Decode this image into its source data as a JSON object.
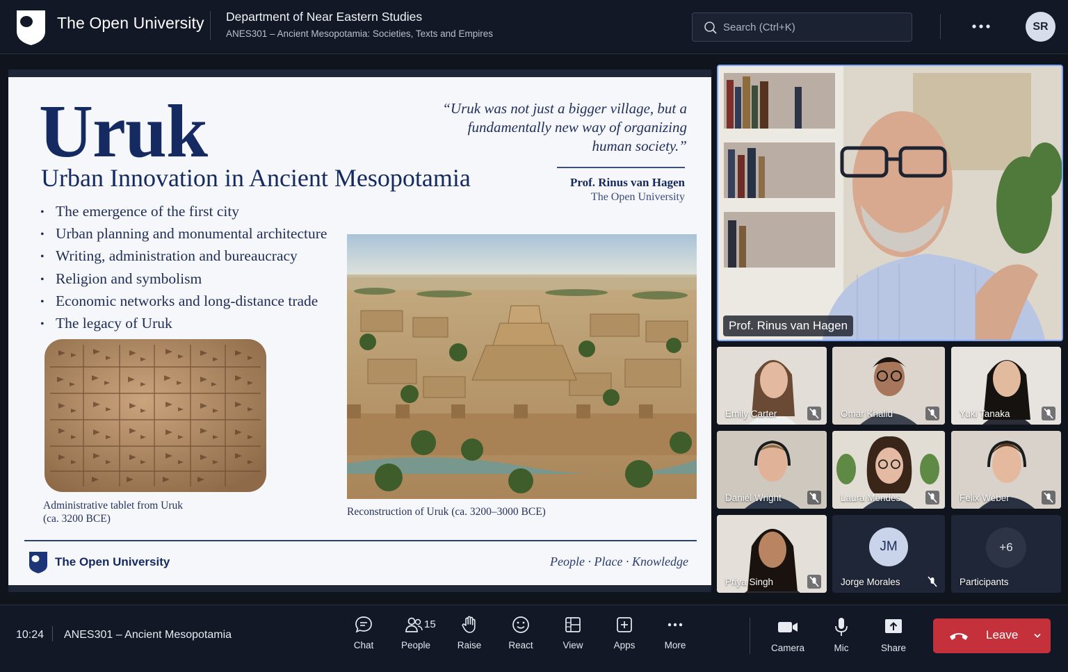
{
  "topbar": {
    "brand": "The Open University",
    "department": "Department of Near Eastern Studies",
    "course": "ANES301 – Ancient Mesopotamia: Societies, Texts and Empires",
    "search_placeholder": "Search (Ctrl+K)",
    "avatar_initials": "SR"
  },
  "slide": {
    "title": "Uruk",
    "subtitle": "Urban Innovation in Ancient Mesopotamia",
    "quote": "“Uruk was not just a bigger village, but a fundamentally new way of organizing human society.”",
    "author": "Prof. Rinus van Hagen",
    "author_affiliation": "The Open University",
    "bullets": [
      "The emergence of the first city",
      "Urban planning and monumental architecture",
      "Writing, administration and bureaucracy",
      "Religion and symbolism",
      "Economic networks and long-distance trade",
      "The legacy of Uruk"
    ],
    "tablet_caption_1": "Administrative tablet from Uruk",
    "tablet_caption_2": "(ca. 3200 BCE)",
    "city_caption": "Reconstruction of Uruk (ca. 3200–3000 BCE)",
    "footer_brand": "The Open University",
    "footer_tagline": "People · Place · Knowledge"
  },
  "main_video": {
    "name": "Prof. Rinus van Hagen"
  },
  "participants": [
    {
      "name": "Emily Carter"
    },
    {
      "name": "Omar Khalid"
    },
    {
      "name": "Yuki Tanaka"
    },
    {
      "name": "Daniel Wright"
    },
    {
      "name": "Laura Mendes"
    },
    {
      "name": "Felix Weber"
    },
    {
      "name": "Priya Singh"
    },
    {
      "name": "Jorge Morales",
      "initials": "JM"
    }
  ],
  "overflow": {
    "count": "+6",
    "label": "Participants"
  },
  "bottombar": {
    "time": "10:24",
    "meeting_title": "ANES301 – Ancient Mesopotamia",
    "people_count": "15",
    "controls": {
      "chat": "Chat",
      "people": "People",
      "raise": "Raise",
      "react": "React",
      "view": "View",
      "apps": "Apps",
      "more": "More",
      "camera": "Camera",
      "mic": "Mic",
      "share": "Share",
      "leave": "Leave"
    }
  },
  "colors": {
    "accent": "#7da6ff",
    "leave": "#c4313a",
    "slide_navy": "#142a61"
  }
}
